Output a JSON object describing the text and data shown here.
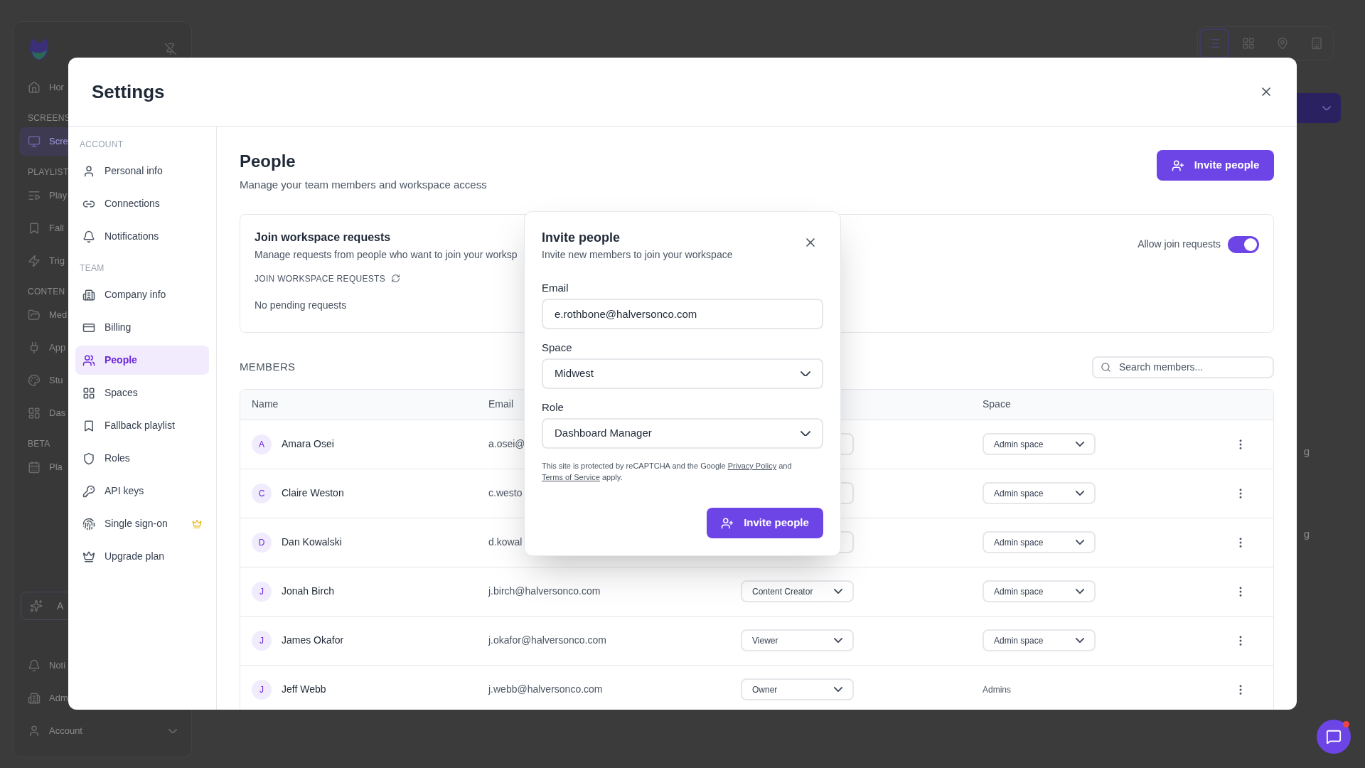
{
  "background": {
    "sidebar": {
      "items": [
        {
          "kind": "item",
          "label": "Hor",
          "selected": false
        },
        {
          "kind": "section",
          "label": "SCREENS"
        },
        {
          "kind": "item",
          "label": "Scre",
          "selected": true
        },
        {
          "kind": "section",
          "label": "PLAYLIST"
        },
        {
          "kind": "item",
          "label": "Play",
          "selected": false
        },
        {
          "kind": "item",
          "label": "Fall",
          "selected": false
        },
        {
          "kind": "item",
          "label": "Trig",
          "selected": false
        },
        {
          "kind": "section",
          "label": "CONTEN"
        },
        {
          "kind": "item",
          "label": "Med",
          "selected": false
        },
        {
          "kind": "item",
          "label": "App",
          "selected": false
        },
        {
          "kind": "item",
          "label": "Stu",
          "selected": false
        },
        {
          "kind": "item",
          "label": "Das",
          "selected": false
        },
        {
          "kind": "section",
          "label": "BETA"
        },
        {
          "kind": "item",
          "label": "Pla",
          "selected": false
        }
      ],
      "assistant_button": "A",
      "bottom_items": [
        {
          "label": "Noti"
        },
        {
          "label": "Adm"
        },
        {
          "label": "Account"
        }
      ]
    },
    "toolbar": [
      {
        "selected": true
      },
      {
        "selected": false
      },
      {
        "selected": false
      },
      {
        "selected": false
      }
    ],
    "table_fragments": [
      "g",
      "g"
    ],
    "chat": {
      "unread": true
    }
  },
  "settings": {
    "title": "Settings",
    "nav": {
      "sections": [
        {
          "label": "ACCOUNT",
          "items": [
            {
              "label": "Personal info",
              "selected": false
            },
            {
              "label": "Connections",
              "selected": false
            },
            {
              "label": "Notifications",
              "selected": false
            }
          ]
        },
        {
          "label": "TEAM",
          "items": [
            {
              "label": "Company info",
              "selected": false
            },
            {
              "label": "Billing",
              "selected": false
            },
            {
              "label": "People",
              "selected": true
            },
            {
              "label": "Spaces",
              "selected": false
            },
            {
              "label": "Fallback playlist",
              "selected": false
            },
            {
              "label": "Roles",
              "selected": false
            },
            {
              "label": "API keys",
              "selected": false
            },
            {
              "label": "Single sign-on",
              "selected": false,
              "premium": true
            },
            {
              "label": "Upgrade plan",
              "selected": false
            }
          ]
        }
      ]
    },
    "page": {
      "title": "People",
      "subtitle": "Manage your team members and workspace access",
      "invite_button": "Invite people"
    },
    "join_requests": {
      "title": "Join workspace requests",
      "description": "Manage requests from people who want to join your worksp",
      "list_label": "JOIN WORKSPACE REQUESTS",
      "empty_text": "No pending requests",
      "toggle": {
        "label": "Allow join requests",
        "on": true
      }
    },
    "members": {
      "label": "MEMBERS",
      "search": {
        "placeholder": "Search members..."
      },
      "columns": [
        "Name",
        "Email",
        "Space"
      ],
      "rows": [
        {
          "initial": "A",
          "name": "Amara Osei",
          "email": "a.osei@",
          "space": {
            "kind": "select",
            "value": "Admin space"
          }
        },
        {
          "initial": "C",
          "name": "Claire Weston",
          "email": "c.westo",
          "space": {
            "kind": "select",
            "value": "Admin space"
          }
        },
        {
          "initial": "D",
          "name": "Dan Kowalski",
          "email": "d.kowal",
          "space": {
            "kind": "select",
            "value": "Admin space"
          }
        },
        {
          "initial": "J",
          "name": "Jonah Birch",
          "email": "j.birch@halversonco.com",
          "role": "Content Creator",
          "space": {
            "kind": "select",
            "value": "Admin space"
          }
        },
        {
          "initial": "J",
          "name": "James Okafor",
          "email": "j.okafor@halversonco.com",
          "role": "Viewer",
          "space": {
            "kind": "select",
            "value": "Admin space"
          }
        },
        {
          "initial": "J",
          "name": "Jeff Webb",
          "email": "j.webb@halversonco.com",
          "role": "Owner",
          "space": {
            "kind": "text",
            "value": "Admins"
          }
        }
      ]
    }
  },
  "invite_dialog": {
    "title": "Invite people",
    "subtitle": "Invite new members to join your workspace",
    "fields": [
      {
        "kind": "input",
        "label": "Email",
        "value": "e.rothbone@halversonco.com"
      },
      {
        "kind": "select",
        "label": "Space",
        "value": "Midwest"
      },
      {
        "kind": "select",
        "label": "Role",
        "value": "Dashboard Manager"
      }
    ],
    "notice": {
      "text_before": "This site is protected by reCAPTCHA and the Google ",
      "link_1": "Privacy Policy",
      "text_middle": " and ",
      "link_2": "Terms of Service",
      "text_after": " apply."
    },
    "submit": "Invite people"
  }
}
